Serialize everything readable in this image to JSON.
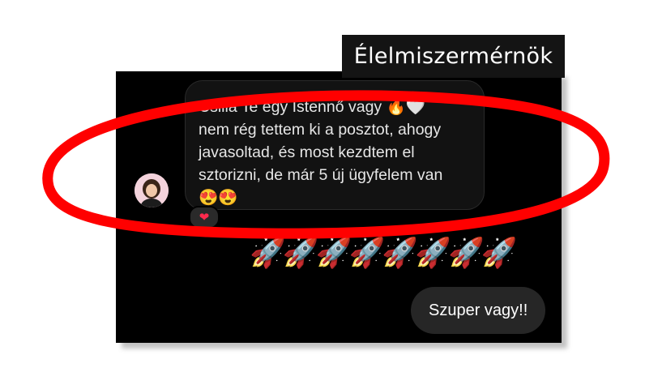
{
  "label": "Élelmiszermérnök",
  "message": {
    "text": "Csilla Te egy Istennő vagy 🔥🤍\nnem rég tettem ki a posztot, ahogy\njavasoltad, és most kezdtem el\nsztorizni, de már 5 új ügyfelem van\n😍😍",
    "reaction": "❤"
  },
  "rockets": "🚀🚀🚀🚀🚀🚀🚀🚀",
  "reply": "Szuper vagy!!",
  "colors": {
    "chat_bg": "#000000",
    "bubble_bg": "#121212",
    "reply_bg": "#262626",
    "highlight": "#ff0000"
  }
}
